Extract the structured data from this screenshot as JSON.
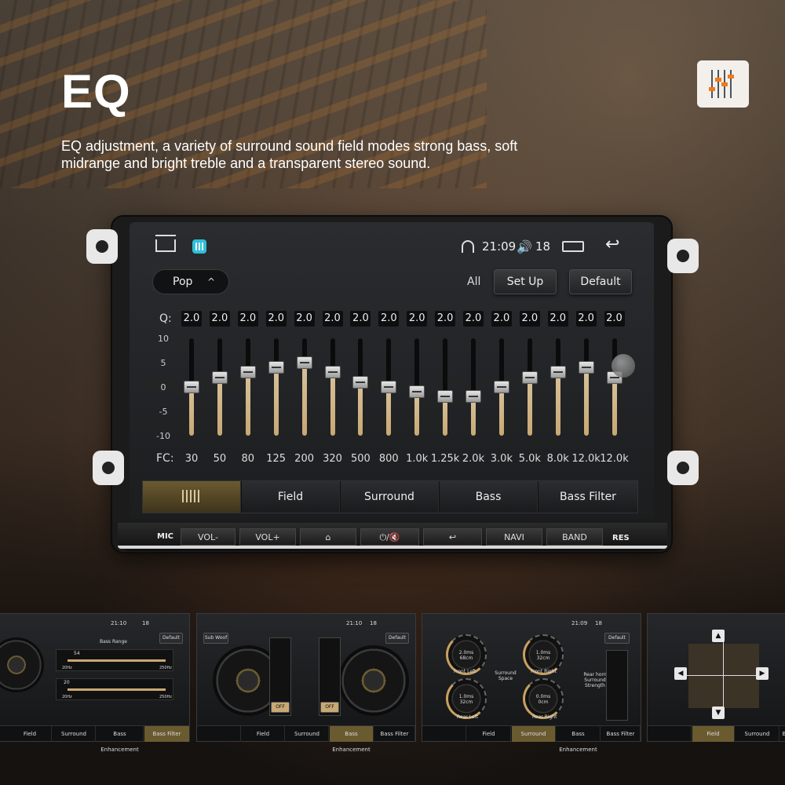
{
  "header": {
    "title": "EQ",
    "subtitle": "EQ adjustment, a variety of surround sound field modes strong bass, soft midrange and bright treble and a transparent stereo sound."
  },
  "status": {
    "time": "21:09",
    "volume": "18"
  },
  "preset": {
    "label": "Pop",
    "chevron": "^"
  },
  "controls": {
    "all": "All",
    "setup": "Set Up",
    "default": "Default"
  },
  "eq": {
    "q_label": "Q:",
    "fc_label": "FC:",
    "scale": [
      "10",
      "5",
      "0",
      "-5",
      "-10"
    ],
    "bands": [
      {
        "q": "2.0",
        "fc": "30",
        "gain": 0
      },
      {
        "q": "2.0",
        "fc": "50",
        "gain": 2
      },
      {
        "q": "2.0",
        "fc": "80",
        "gain": 3
      },
      {
        "q": "2.0",
        "fc": "125",
        "gain": 4
      },
      {
        "q": "2.0",
        "fc": "200",
        "gain": 5
      },
      {
        "q": "2.0",
        "fc": "320",
        "gain": 3
      },
      {
        "q": "2.0",
        "fc": "500",
        "gain": 1
      },
      {
        "q": "2.0",
        "fc": "800",
        "gain": 0
      },
      {
        "q": "2.0",
        "fc": "1.0k",
        "gain": -1
      },
      {
        "q": "2.0",
        "fc": "1.25k",
        "gain": -2
      },
      {
        "q": "2.0",
        "fc": "2.0k",
        "gain": -2
      },
      {
        "q": "2.0",
        "fc": "3.0k",
        "gain": 0
      },
      {
        "q": "2.0",
        "fc": "5.0k",
        "gain": 2
      },
      {
        "q": "2.0",
        "fc": "8.0k",
        "gain": 3
      },
      {
        "q": "2.0",
        "fc": "12.0k",
        "gain": 4
      },
      {
        "q": "2.0",
        "fc": "12.0k",
        "gain": 2
      }
    ]
  },
  "tabs": [
    "",
    "Field",
    "Surround",
    "Bass Enhancement",
    "Bass Filter"
  ],
  "hardware": {
    "mic": "MIC",
    "buttons": [
      "VOL-",
      "VOL+",
      "⌂",
      "⏻/🔇",
      "↩",
      "NAVI",
      "BAND"
    ],
    "res": "RES"
  },
  "thumbs": {
    "p1": {
      "title": "Bass Range",
      "default": "Default",
      "slider1": {
        "value": "54",
        "min": "20Hz",
        "max": "250Hz"
      },
      "slider2": {
        "value": "20",
        "min": "20Hz",
        "max": "250Hz"
      },
      "tabs": [
        "Field",
        "Surround",
        "Bass Enhancement",
        "Bass Filter"
      ],
      "time": "21:10",
      "vol": "18"
    },
    "p2": {
      "subwoof": "Sub Woof",
      "default": "Default",
      "off1": "OFF",
      "off2": "OFF",
      "tabs": [
        "",
        "Field",
        "Surround",
        "Bass Enhancement",
        "Bass Filter"
      ],
      "time": "21:10",
      "vol": "18"
    },
    "p3": {
      "default": "Default",
      "center": "Surround Space",
      "right": "Rear horn Surround Strength",
      "fl": {
        "v1": "2.0ms",
        "v2": "68cm",
        "label": "Front Left"
      },
      "fr": {
        "v1": "1.0ms",
        "v2": "32cm",
        "label": "Front Right"
      },
      "rl": {
        "v1": "1.0ms",
        "v2": "32cm",
        "label": "Rear Left"
      },
      "rr": {
        "v1": "0.0ms",
        "v2": "0cm",
        "label": "Rear Right"
      },
      "tabs": [
        "",
        "Field",
        "Surround",
        "Bass Enhancement",
        "Bass Filter"
      ],
      "time": "21:09",
      "vol": "18"
    },
    "p4": {
      "tabs": [
        "",
        "Field",
        "Surround",
        "Ba"
      ]
    }
  }
}
